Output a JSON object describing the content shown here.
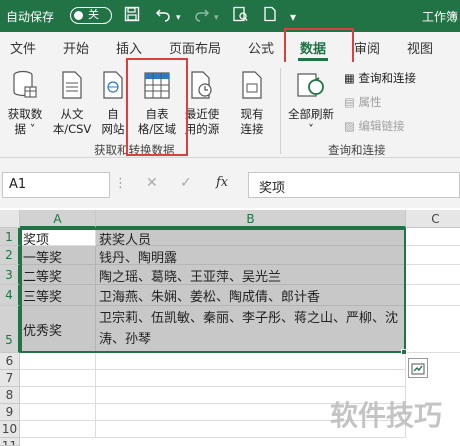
{
  "titlebar": {
    "autosave_label": "自动保存",
    "autosave_state": "关",
    "window_title": "工作簿"
  },
  "tabs": [
    "文件",
    "开始",
    "插入",
    "页面布局",
    "公式",
    "数据",
    "审阅",
    "视图"
  ],
  "active_tab": "数据",
  "ribbon": {
    "get_data_line1": "获取数",
    "get_data_line2": "据 ˅",
    "from_text_line1": "从文",
    "from_text_line2": "本/CSV",
    "from_web_line1": "自",
    "from_web_line2": "网站",
    "from_table_line1": "自表",
    "from_table_line2": "格/区域",
    "recent_line1": "最近使",
    "recent_line2": "用的源",
    "existing_line1": "现有",
    "existing_line2": "连接",
    "group1_label": "获取和转换数据",
    "refresh_line1": "全部刷新",
    "refresh_line2": "˅",
    "queries_label": "查询和连接",
    "properties_label": "属性",
    "edit_links_label": "编辑链接",
    "group2_label": "查询和连接"
  },
  "formula": {
    "name_box": "A1",
    "content": "奖项"
  },
  "columns": [
    "A",
    "B",
    "C"
  ],
  "rows": [
    {
      "num": "1",
      "a": "奖项",
      "b": "获奖人员"
    },
    {
      "num": "2",
      "a": "一等奖",
      "b": "钱丹、陶明露"
    },
    {
      "num": "3",
      "a": "二等奖",
      "b": "陶之瑶、葛晓、王亚萍、吴光兰"
    },
    {
      "num": "4",
      "a": "三等奖",
      "b": "卫海燕、朱娴、姜松、陶成倩、郎计香"
    },
    {
      "num": "5",
      "a": "优秀奖",
      "b": "卫宗莉、伍凯敏、秦丽、李子彤、蒋之山、严柳、沈涛、孙琴"
    }
  ],
  "empty_rows": [
    "6",
    "7",
    "8",
    "9",
    "10",
    "11"
  ],
  "watermark": "软件技巧",
  "colors": {
    "accent": "#217346",
    "highlight": "#d9413c",
    "selection": "#c8c8c8"
  }
}
